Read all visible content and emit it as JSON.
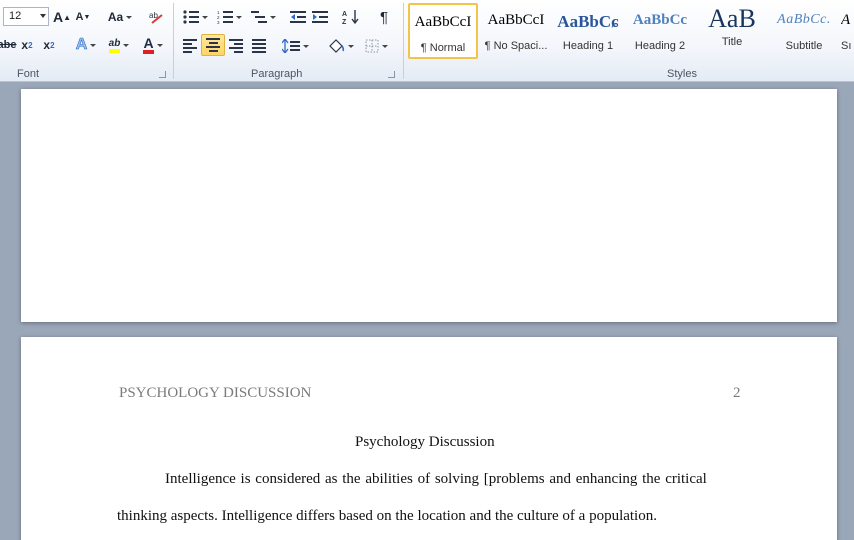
{
  "ribbon": {
    "font_group": {
      "label": "Font",
      "font_size": "12",
      "grow_font": "A",
      "shrink_font": "A",
      "change_case": "Aa",
      "strikethrough": "abe",
      "subscript": "x",
      "superscript": "x",
      "text_effects": "A",
      "highlight": "ab",
      "font_color": "A",
      "highlight_color": "#ffff00",
      "font_color_value": "#e02020"
    },
    "paragraph_group": {
      "label": "Paragraph",
      "pilcrow": "¶",
      "sort": "A↓Z",
      "active_alignment": "center"
    },
    "styles_group": {
      "label": "Styles",
      "styles": [
        {
          "sample": "AaBbCcI",
          "name": "¶ Normal",
          "active": true
        },
        {
          "sample": "AaBbCcI",
          "name": "¶ No Spaci...",
          "active": false
        },
        {
          "sample": "AaBbCɕ",
          "name": "Heading 1",
          "active": false
        },
        {
          "sample": "AaBbCc",
          "name": "Heading 2",
          "active": false
        },
        {
          "sample": "AaB",
          "name": "Title",
          "active": false
        },
        {
          "sample": "AaBbCc.",
          "name": "Subtitle",
          "active": false
        },
        {
          "sample": "A",
          "name": "Sı",
          "active": false
        }
      ],
      "heading_color": "#2a5699",
      "subtitle_color": "#4f81bd"
    }
  },
  "document": {
    "running_head": "PSYCHOLOGY DISCUSSION",
    "page_number": "2",
    "title": "Psychology Discussion",
    "line1": "Intelligence is considered as the abilities  of solving  [problems  and enhancing the critical",
    "line2": "thinking aspects.  Intelligence differs based on the location and the culture of a population."
  }
}
